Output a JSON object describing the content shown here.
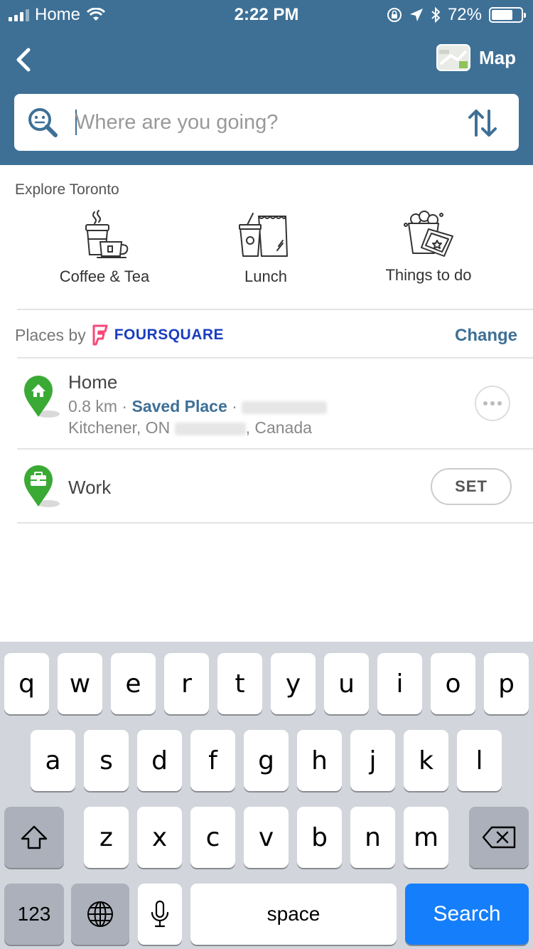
{
  "status_bar": {
    "carrier": "Home",
    "time": "2:22 PM",
    "battery": "72%",
    "battery_level": 0.72
  },
  "header": {
    "map_label": "Map",
    "search_placeholder": "Where are you going?"
  },
  "explore": {
    "title": "Explore Toronto",
    "categories": [
      {
        "label": "Coffee & Tea",
        "icon": "coffee-cups-icon"
      },
      {
        "label": "Lunch",
        "icon": "lunch-bag-icon"
      },
      {
        "label": "Things to do",
        "icon": "popcorn-ticket-icon"
      }
    ]
  },
  "places": {
    "places_by": "Places by",
    "provider": "FOURSQUARE",
    "change_label": "Change",
    "home": {
      "title": "Home",
      "distance": "0.8 km",
      "separator": "·",
      "saved": "Saved Place",
      "city": "Kitchener, ON",
      "country": ", Canada"
    },
    "work": {
      "title": "Work",
      "set_label": "SET"
    }
  },
  "keyboard": {
    "row1": [
      "q",
      "w",
      "e",
      "r",
      "t",
      "y",
      "u",
      "i",
      "o",
      "p"
    ],
    "row2": [
      "a",
      "s",
      "d",
      "f",
      "g",
      "h",
      "j",
      "k",
      "l"
    ],
    "row3": [
      "z",
      "x",
      "c",
      "v",
      "b",
      "n",
      "m"
    ],
    "num_label": "123",
    "space_label": "space",
    "search_label": "Search"
  },
  "colors": {
    "header_bg": "#3e7096",
    "accent": "#3e7096",
    "pin_green": "#3aaa35",
    "foursquare_pink": "#f94877",
    "foursquare_blue": "#1a3ec0",
    "search_key": "#157efb"
  }
}
